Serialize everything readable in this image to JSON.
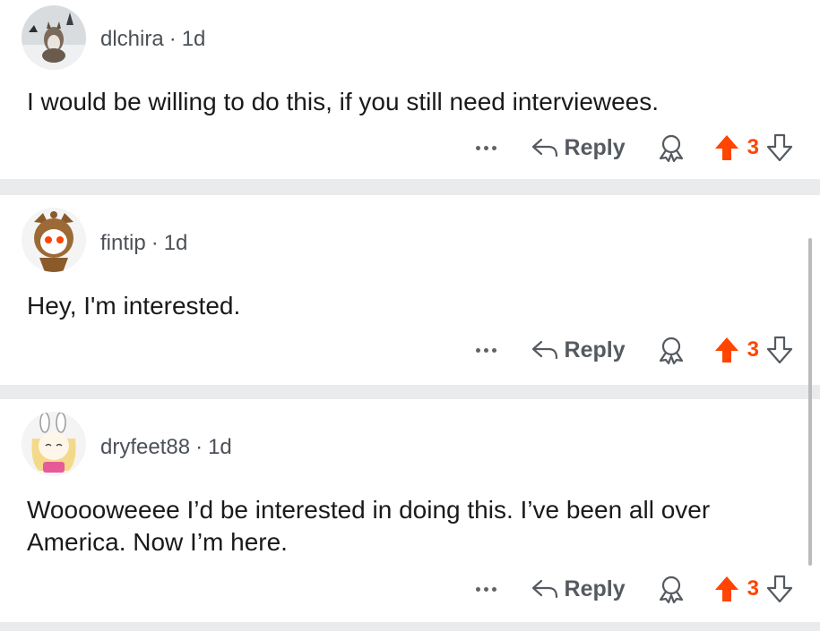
{
  "comments": [
    {
      "username": "dlchira",
      "separator": "·",
      "age": "1d",
      "body": "I would be willing to do this, if you still need interviewees.",
      "reply_label": "Reply",
      "score": "3"
    },
    {
      "username": "fintip",
      "separator": "·",
      "age": "1d",
      "body": "Hey, I'm interested.",
      "reply_label": "Reply",
      "score": "3"
    },
    {
      "username": "dryfeet88",
      "separator": "·",
      "age": "1d",
      "body": "Wooooweeee I’d be interested in doing this. I’ve been all over America. Now I’m here.",
      "reply_label": "Reply",
      "score": "3"
    }
  ],
  "icons": {
    "more": "more-icon",
    "reply": "reply-arrow-icon",
    "award": "award-icon",
    "upvote": "upvote-arrow-icon",
    "downvote": "downvote-arrow-icon"
  },
  "colors": {
    "upvote_active": "#ff4500",
    "text": "#1a1a1b",
    "meta": "#4c5157",
    "divider": "#e9ebed"
  }
}
